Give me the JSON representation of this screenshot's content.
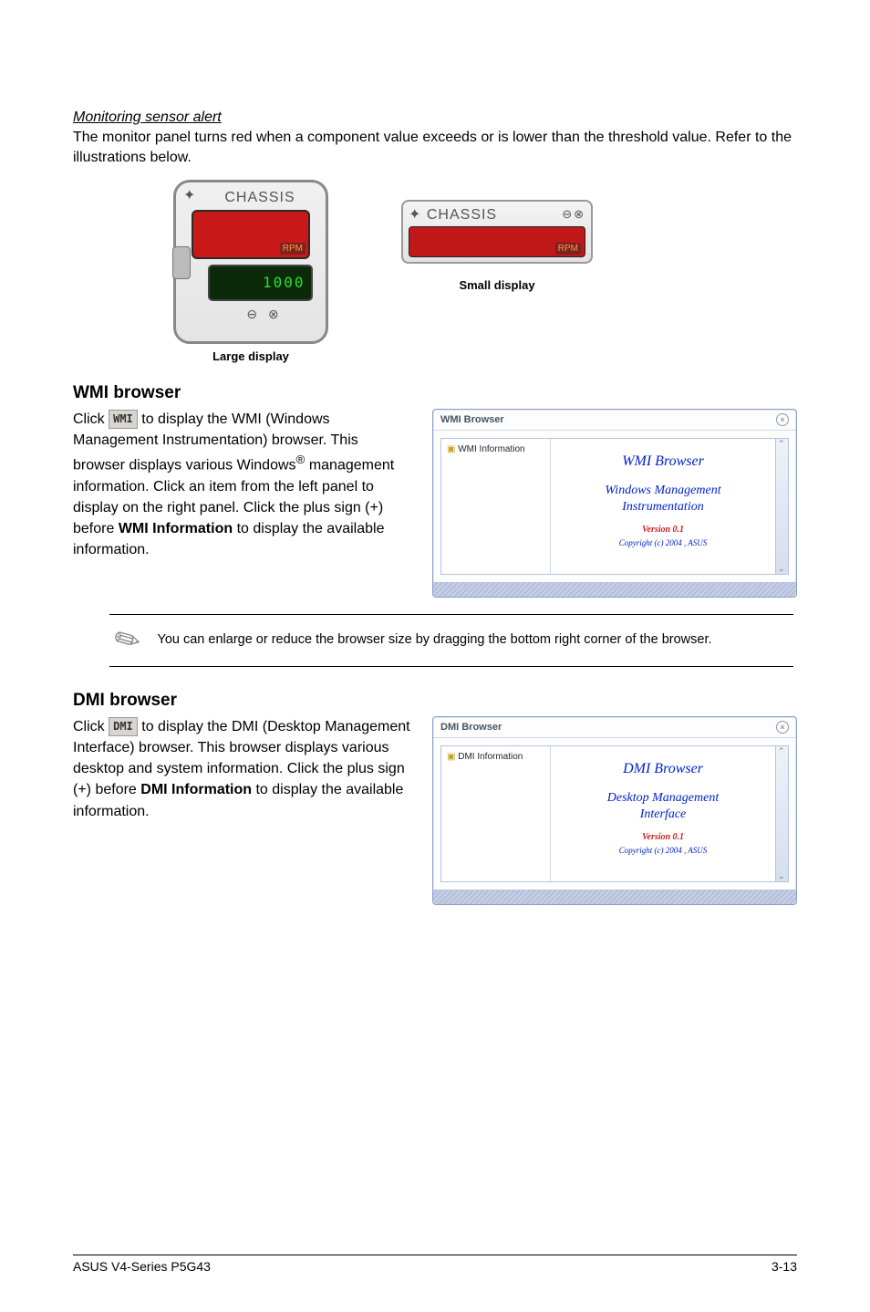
{
  "monitor_alert": {
    "heading": "Monitoring sensor alert",
    "body": "The monitor panel turns red when a component value exceeds or is lower than the threshold value. Refer to the illustrations below.",
    "large": {
      "label": "CHASSIS",
      "rpm": "RPM",
      "green_value": "1000",
      "caption": "Large display"
    },
    "small": {
      "label": "CHASSIS",
      "rpm": "RPM",
      "caption": "Small display"
    }
  },
  "wmi": {
    "heading": "WMI browser",
    "btn": "WMI",
    "text_before_btn": "Click ",
    "text_after_btn": " to display the WMI (Windows Management Instrumentation) browser. This browser displays various Windows",
    "text_rest": " management information. Click an item from the left panel to display on the right panel. Click the plus sign (+) before ",
    "bold": "WMI Information",
    "text_end": " to display the available information.",
    "window": {
      "title": "WMI Browser",
      "tree_item": "WMI Information",
      "content_title": "WMI  Browser",
      "content_sub1": "Windows Management",
      "content_sub2": "Instrumentation",
      "version": "Version  0.1",
      "copyright": "Copyright (c) 2004 ,  ASUS"
    }
  },
  "note": {
    "text": "You can enlarge or reduce the browser size by dragging the bottom right corner of the browser."
  },
  "dmi": {
    "heading": "DMI browser",
    "btn": "DMI",
    "text_before_btn": "Click ",
    "text_after_btn": " to display the DMI (Desktop Management Interface) browser. This browser displays various desktop and system information. Click the plus sign (+) before ",
    "bold": "DMI Information",
    "text_end": " to display the available information.",
    "window": {
      "title": "DMI Browser",
      "tree_item": "DMI Information",
      "content_title": "DMI  Browser",
      "content_sub1": "Desktop Management",
      "content_sub2": "Interface",
      "version": "Version  0.1",
      "copyright": "Copyright (c) 2004 ,  ASUS"
    }
  },
  "footer": {
    "left": "ASUS V4-Series P5G43",
    "right": "3-13"
  },
  "superscript": "®"
}
